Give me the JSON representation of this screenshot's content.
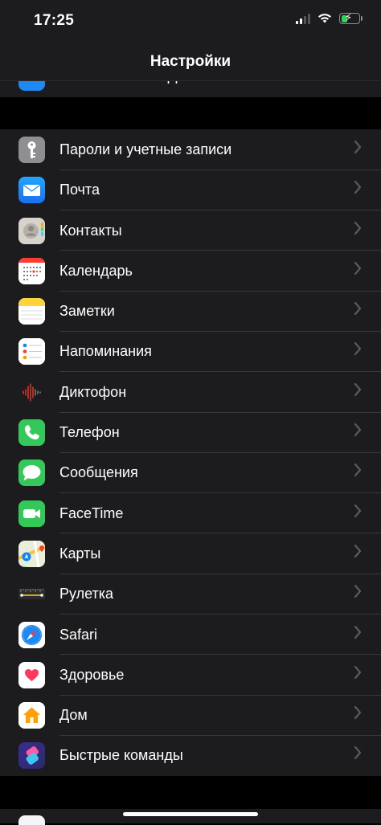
{
  "status_bar": {
    "time": "17:25",
    "signal_icon": "cellular-signal-icon",
    "wifi_icon": "wifi-icon",
    "battery_icon": "battery-charging-icon",
    "battery_level": 0.35,
    "battery_color": "#30d158"
  },
  "header": {
    "title": "Настройки"
  },
  "peek_row": {
    "label": "iTunes Store и App Store"
  },
  "settings": {
    "items": [
      {
        "label": "Пароли и учетные записи",
        "icon": "key-icon",
        "color": "#8e8e93"
      },
      {
        "label": "Почта",
        "icon": "mail-icon",
        "color": "#1e88f5"
      },
      {
        "label": "Контакты",
        "icon": "contacts-icon",
        "color": "#c9c6bd"
      },
      {
        "label": "Календарь",
        "icon": "calendar-icon",
        "color": "#ffffff"
      },
      {
        "label": "Заметки",
        "icon": "notes-icon",
        "color": "#ffffff"
      },
      {
        "label": "Напоминания",
        "icon": "reminders-icon",
        "color": "#ffffff"
      },
      {
        "label": "Диктофон",
        "icon": "voice-memos-icon",
        "color": "#1c1c1e"
      },
      {
        "label": "Телефон",
        "icon": "phone-icon",
        "color": "#34c759"
      },
      {
        "label": "Сообщения",
        "icon": "messages-icon",
        "color": "#34c759"
      },
      {
        "label": "FaceTime",
        "icon": "facetime-icon",
        "color": "#34c759"
      },
      {
        "label": "Карты",
        "icon": "maps-icon",
        "color": "#e9efd7"
      },
      {
        "label": "Рулетка",
        "icon": "measure-icon",
        "color": "#1c1c1e"
      },
      {
        "label": "Safari",
        "icon": "safari-icon",
        "color": "#ffffff"
      },
      {
        "label": "Здоровье",
        "icon": "health-icon",
        "color": "#ffffff"
      },
      {
        "label": "Дом",
        "icon": "home-icon",
        "color": "#ffffff"
      },
      {
        "label": "Быстрые команды",
        "icon": "shortcuts-icon",
        "color": "#3a35b5"
      }
    ]
  },
  "chevron_color": "#5b5b5f",
  "separator_color": "#38383a"
}
